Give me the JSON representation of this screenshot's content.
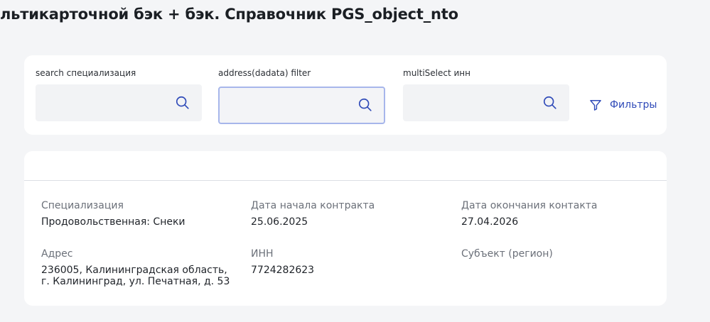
{
  "header": {
    "title": "льтикарточной бэк + бэк. Справочник PGS_object_nto"
  },
  "filters": {
    "fields": [
      {
        "label": "search специализация",
        "value": "",
        "placeholder": "",
        "icon": "search-icon"
      },
      {
        "label": "address(dadata) filter",
        "value": "",
        "placeholder": "",
        "icon": "search-icon"
      },
      {
        "label": "multiSelect инн",
        "value": "",
        "placeholder": "",
        "icon": "search-icon"
      }
    ],
    "filters_button": {
      "label": "Фильтры",
      "icon": "funnel-icon"
    }
  },
  "card": {
    "rows": [
      [
        {
          "label": "Специализация",
          "value": "Продовольственная: Снеки"
        },
        {
          "label": "Дата начала контракта",
          "value": "25.06.2025"
        },
        {
          "label": "Дата окончания контакта",
          "value": "27.04.2026"
        }
      ],
      [
        {
          "label": "Адрес",
          "value_lines": [
            "236005, Калининградская область,",
            "г. Калининград, ул. Печатная, д. 53"
          ]
        },
        {
          "label": "ИНН",
          "value": "7724282623"
        },
        {
          "label": "Субъект (регион)",
          "value": ""
        }
      ]
    ]
  },
  "colors": {
    "background": "#f4f5f7",
    "surface": "#ffffff",
    "accent": "#2f4ab8",
    "focus_border": "#a7b6eb"
  }
}
